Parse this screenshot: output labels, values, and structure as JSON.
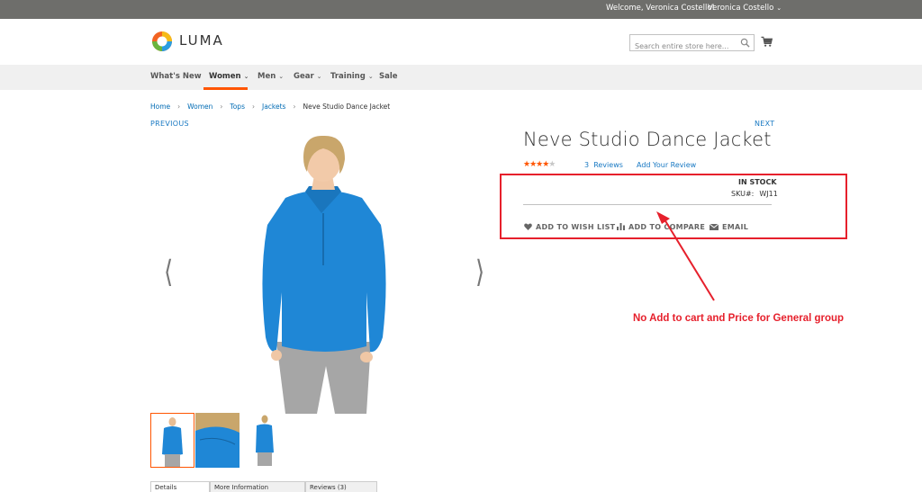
{
  "topbar": {
    "welcome": "Welcome, Veronica Costello!",
    "user_menu": "Veronica Costello"
  },
  "header": {
    "logo_text": "LUMA",
    "search_placeholder": "Search entire store here...",
    "cart_icon": "cart-icon",
    "search_icon": "search-icon"
  },
  "nav": {
    "items": [
      {
        "label": "What's New",
        "has_submenu": false
      },
      {
        "label": "Women",
        "has_submenu": true,
        "active": true
      },
      {
        "label": "Men",
        "has_submenu": true
      },
      {
        "label": "Gear",
        "has_submenu": true
      },
      {
        "label": "Training",
        "has_submenu": true
      },
      {
        "label": "Sale",
        "has_submenu": false
      }
    ]
  },
  "breadcrumb": [
    "Home",
    "Women",
    "Tops",
    "Jackets",
    "Neve Studio Dance Jacket"
  ],
  "pager": {
    "previous": "PREVIOUS",
    "next": "NEXT"
  },
  "product": {
    "name": "Neve Studio Dance Jacket",
    "rating_stars": 4,
    "reviews_count": "3",
    "reviews_label": "Reviews",
    "add_review": "Add Your Review",
    "stock": "IN STOCK",
    "sku_label": "SKU#:",
    "sku": "WJ11",
    "actions": {
      "wishlist": "ADD TO WISH LIST",
      "compare": "ADD TO COMPARE",
      "email": "EMAIL"
    }
  },
  "tabs": [
    "Details",
    "More Information",
    "Reviews (3)"
  ],
  "annotation": {
    "text": "No Add to cart and Price for General group",
    "color": "#e6202c"
  },
  "colors": {
    "accent": "#ff5501",
    "link": "#1979c3",
    "topbar": "#6e6e6b",
    "jacket": "#1f87d6"
  }
}
